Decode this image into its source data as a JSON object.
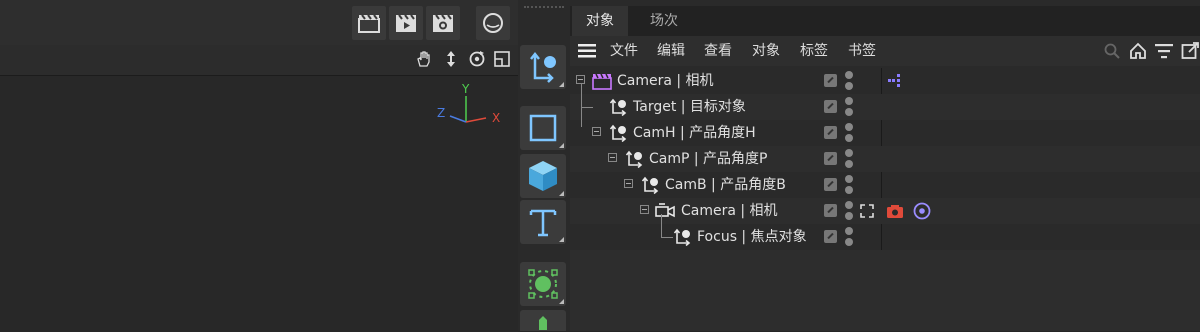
{
  "tabs": {
    "objects": "对象",
    "takes": "场次"
  },
  "menu": {
    "file": "文件",
    "edit": "编辑",
    "view": "查看",
    "object": "对象",
    "tags": "标签",
    "bookmarks": "书签"
  },
  "axis": {
    "x": "X",
    "y": "Y",
    "z": "Z"
  },
  "colors": {
    "accent_blue": "#7fc6ff",
    "cube_blue": "#58b8ea",
    "generator_green": "#60c060",
    "camera_purple": "#c978ff",
    "render_red": "#e04a3a"
  },
  "objects": [
    {
      "name": "Camera | 相机",
      "icon": "camera-clapper-icon"
    },
    {
      "name": "Target | 目标对象",
      "icon": "null-target-icon"
    },
    {
      "name": "CamH | 产品角度H",
      "icon": "null-target-icon"
    },
    {
      "name": "CamP | 产品角度P",
      "icon": "null-target-icon"
    },
    {
      "name": "CamB | 产品角度B",
      "icon": "null-target-icon"
    },
    {
      "name": "Camera | 相机",
      "icon": "camera-icon"
    },
    {
      "name": "Focus | 焦点对象",
      "icon": "null-target-icon"
    }
  ]
}
